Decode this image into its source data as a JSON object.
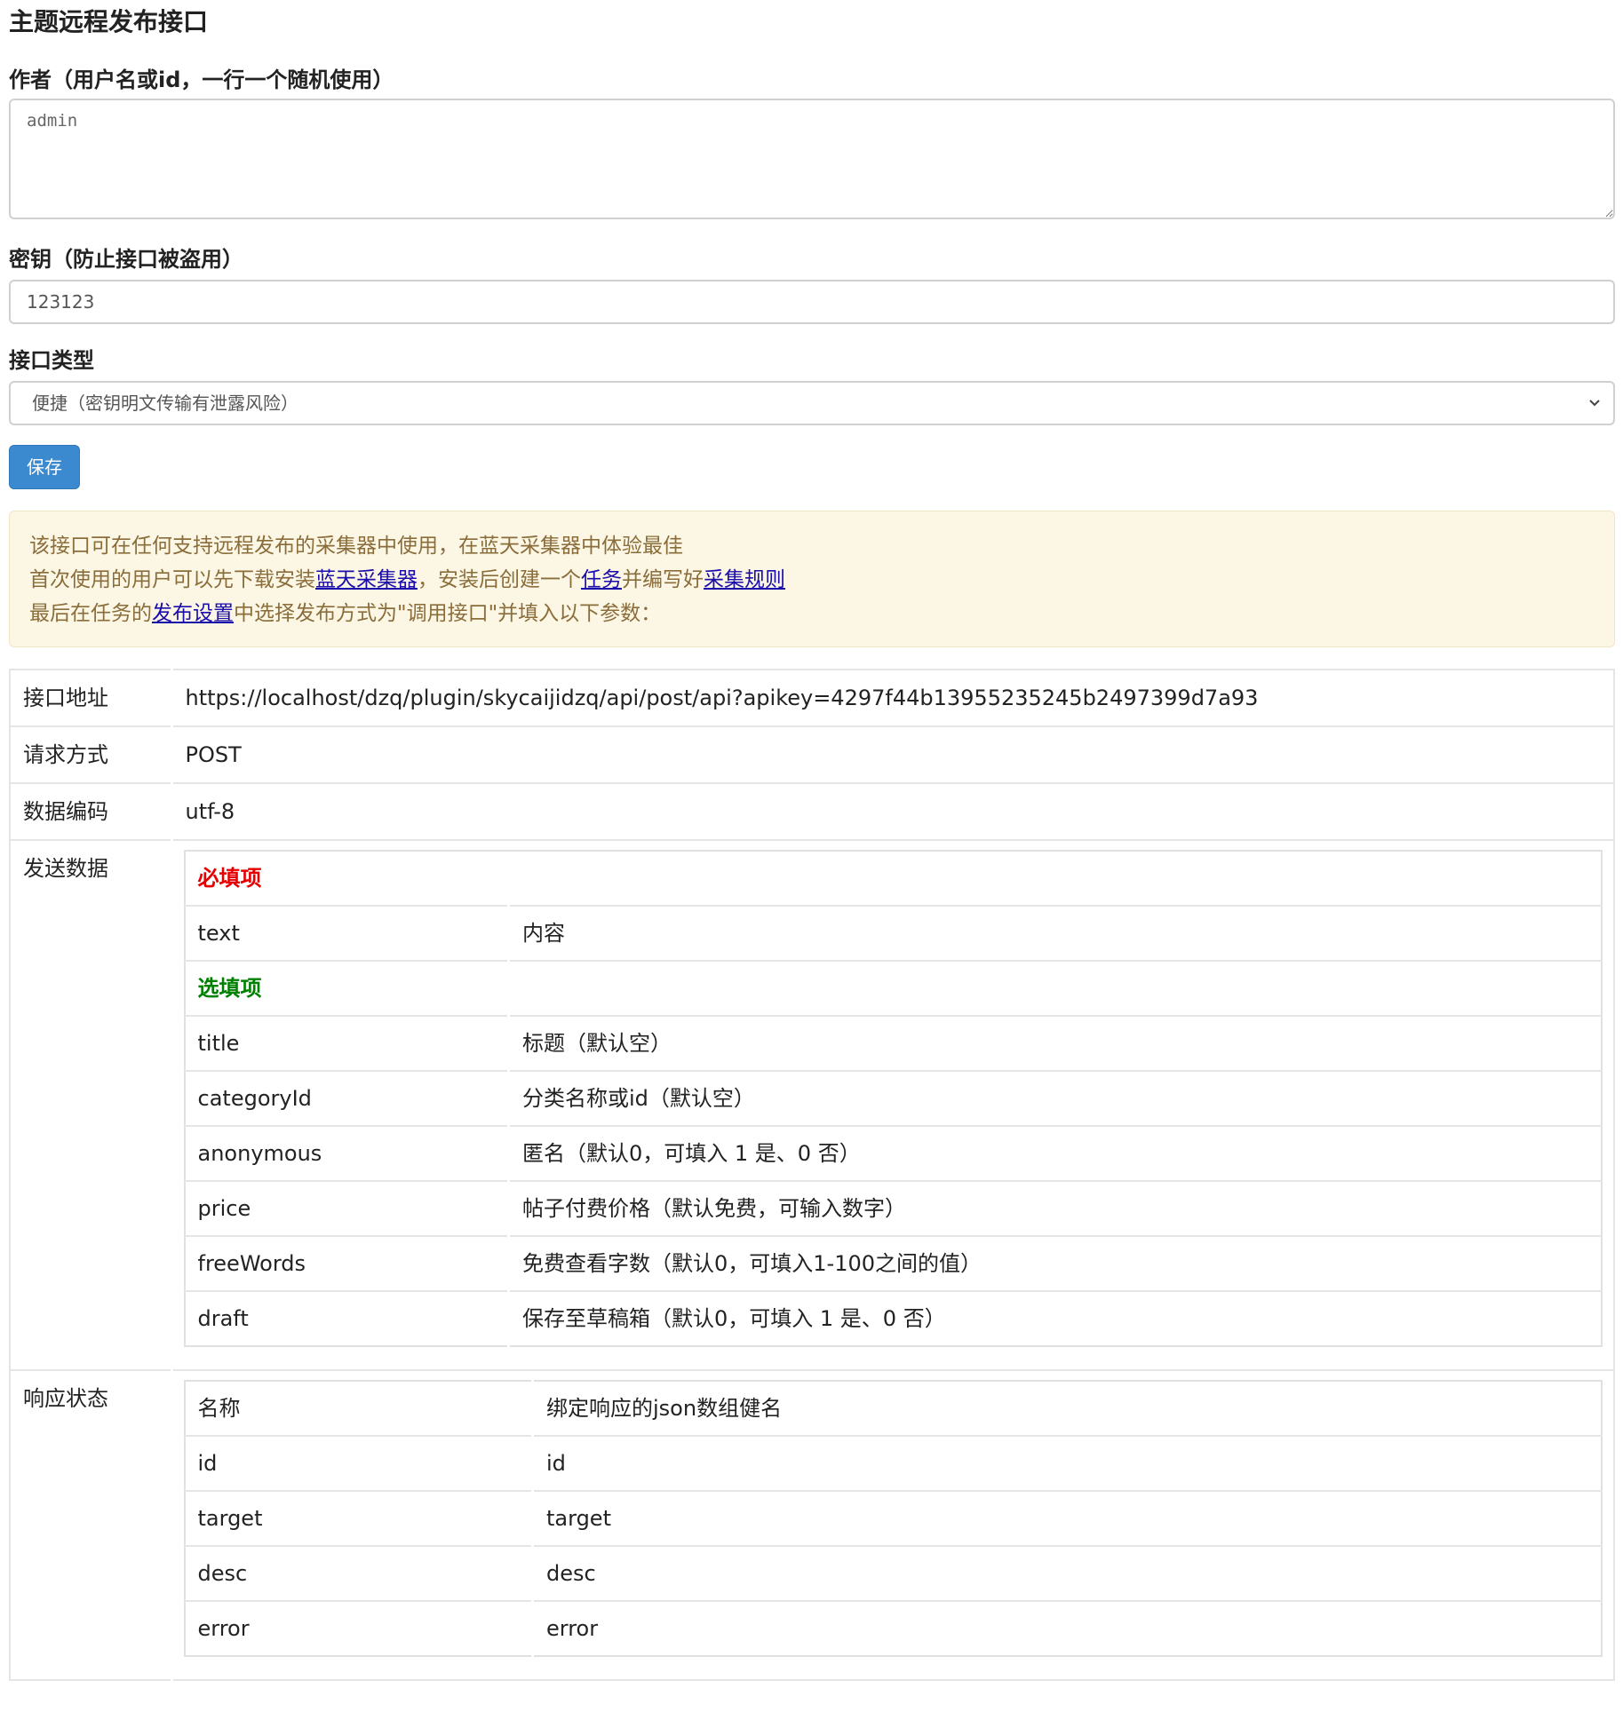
{
  "page": {
    "title": "主题远程发布接口"
  },
  "form": {
    "author": {
      "label": "作者（用户名或id，一行一个随机使用）",
      "value": "admin"
    },
    "secret": {
      "label": "密钥（防止接口被盗用）",
      "value": "123123"
    },
    "api_type": {
      "label": "接口类型",
      "selected": "便捷（密钥明文传输有泄露风险）"
    },
    "save_label": "保存"
  },
  "notice": {
    "line1": "该接口可在任何支持远程发布的采集器中使用，在蓝天采集器中体验最佳",
    "line2_pre": "首次使用的用户可以先下载安装",
    "link_collector": "蓝天采集器",
    "line2_mid1": "，安装后创建一个",
    "link_task": "任务",
    "line2_mid2": "并编写好",
    "link_rule": "采集规则",
    "line3_pre": "最后在任务的",
    "link_publish": "发布设置",
    "line3_post": "中选择发布方式为\"调用接口\"并填入以下参数："
  },
  "info": {
    "url_key": "接口地址",
    "url_value": "https://localhost/dzq/plugin/skycaijidzq/api/post/api?apikey=4297f44b13955235245b2497399d7a93",
    "method_key": "请求方式",
    "method_value": "POST",
    "encoding_key": "数据编码",
    "encoding_value": "utf-8",
    "send_key": "发送数据",
    "response_key": "响应状态"
  },
  "send_data": {
    "required_heading": "必填项",
    "required": [
      {
        "name": "text",
        "desc": "内容"
      }
    ],
    "optional_heading": "选填项",
    "optional": [
      {
        "name": "title",
        "desc": "标题（默认空）"
      },
      {
        "name": "categoryId",
        "desc": "分类名称或id（默认空）"
      },
      {
        "name": "anonymous",
        "desc": "匿名（默认0，可填入 1 是、0 否）"
      },
      {
        "name": "price",
        "desc": "帖子付费价格（默认免费，可输入数字）"
      },
      {
        "name": "freeWords",
        "desc": "免费查看字数（默认0，可填入1-100之间的值）"
      },
      {
        "name": "draft",
        "desc": "保存至草稿箱（默认0，可填入 1 是、0 否）"
      }
    ]
  },
  "response": {
    "header": {
      "name": "名称",
      "key": "绑定响应的json数组健名"
    },
    "rows": [
      {
        "name": "id",
        "key": "id"
      },
      {
        "name": "target",
        "key": "target"
      },
      {
        "name": "desc",
        "key": "desc"
      },
      {
        "name": "error",
        "key": "error"
      }
    ]
  },
  "icons": {
    "select_chevron": "chevron-down-icon",
    "resize_handle": "resize-grip-icon"
  }
}
